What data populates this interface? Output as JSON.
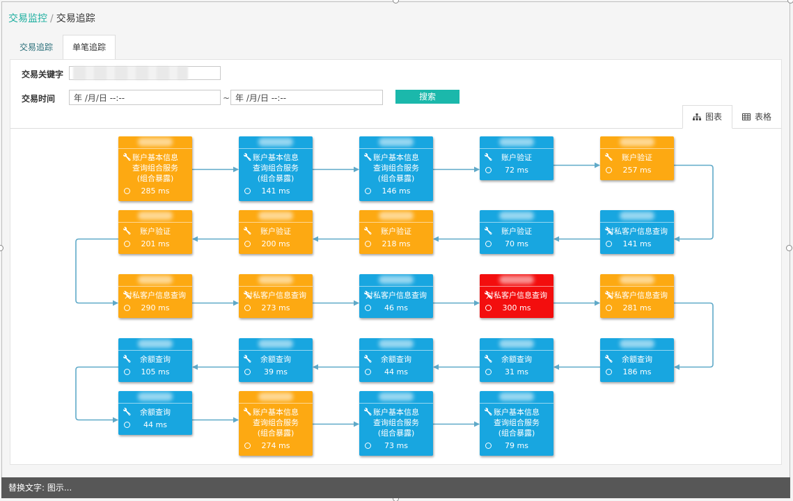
{
  "breadcrumb": {
    "parent": "交易监控",
    "separator": "/",
    "current": "交易追踪"
  },
  "tabs": [
    {
      "label": "交易追踪",
      "active": false
    },
    {
      "label": "单笔追踪",
      "active": true
    }
  ],
  "form": {
    "keyword_label": "交易关键字",
    "time_label": "交易时间",
    "date_start": "年 /月/日 --:--",
    "date_end": "年 /月/日 --:--",
    "tilde": "~",
    "search_label": "搜索"
  },
  "view_tabs": [
    {
      "label": "图表",
      "icon": "sitemap-icon",
      "active": true
    },
    {
      "label": "表格",
      "icon": "table-icon",
      "active": false
    }
  ],
  "colors": {
    "blue": "#18a6e0",
    "orange": "#fda912",
    "red": "#f30e0e",
    "arrow": "#5fa9c8",
    "accent": "#1bb8ab"
  },
  "nodes": [
    {
      "title": "账户基本信息查询组合服务(组合暴露)",
      "time": "285 ms",
      "color": "orange"
    },
    {
      "title": "账户基本信息查询组合服务(组合暴露)",
      "time": "141 ms",
      "color": "blue"
    },
    {
      "title": "账户基本信息查询组合服务(组合暴露)",
      "time": "146 ms",
      "color": "blue"
    },
    {
      "title": "账户验证",
      "time": "72 ms",
      "color": "blue"
    },
    {
      "title": "账户验证",
      "time": "257 ms",
      "color": "orange"
    },
    {
      "title": "对私客户信息查询",
      "time": "141 ms",
      "color": "blue"
    },
    {
      "title": "账户验证",
      "time": "70 ms",
      "color": "blue"
    },
    {
      "title": "账户验证",
      "time": "218 ms",
      "color": "orange"
    },
    {
      "title": "账户验证",
      "time": "200 ms",
      "color": "orange"
    },
    {
      "title": "账户验证",
      "time": "201 ms",
      "color": "orange"
    },
    {
      "title": "对私客户信息查询",
      "time": "290 ms",
      "color": "orange"
    },
    {
      "title": "对私客户信息查询",
      "time": "273 ms",
      "color": "orange"
    },
    {
      "title": "对私客户信息查询",
      "time": "46 ms",
      "color": "blue"
    },
    {
      "title": "对私客户信息查询",
      "time": "300 ms",
      "color": "red"
    },
    {
      "title": "对私客户信息查询",
      "time": "281 ms",
      "color": "orange"
    },
    {
      "title": "余额查询",
      "time": "186 ms",
      "color": "blue"
    },
    {
      "title": "余额查询",
      "time": "31 ms",
      "color": "blue"
    },
    {
      "title": "余额查询",
      "time": "44 ms",
      "color": "blue"
    },
    {
      "title": "余额查询",
      "time": "39 ms",
      "color": "blue"
    },
    {
      "title": "余额查询",
      "time": "105 ms",
      "color": "blue"
    },
    {
      "title": "余额查询",
      "time": "44 ms",
      "color": "blue"
    },
    {
      "title": "账户基本信息查询组合服务(组合暴露)",
      "time": "274 ms",
      "color": "orange"
    },
    {
      "title": "账户基本信息查询组合服务(组合暴露)",
      "time": "73 ms",
      "color": "blue"
    },
    {
      "title": "账户基本信息查询组合服务(组合暴露)",
      "time": "79 ms",
      "color": "blue"
    }
  ],
  "alt_text": "替换文字: 图示..."
}
